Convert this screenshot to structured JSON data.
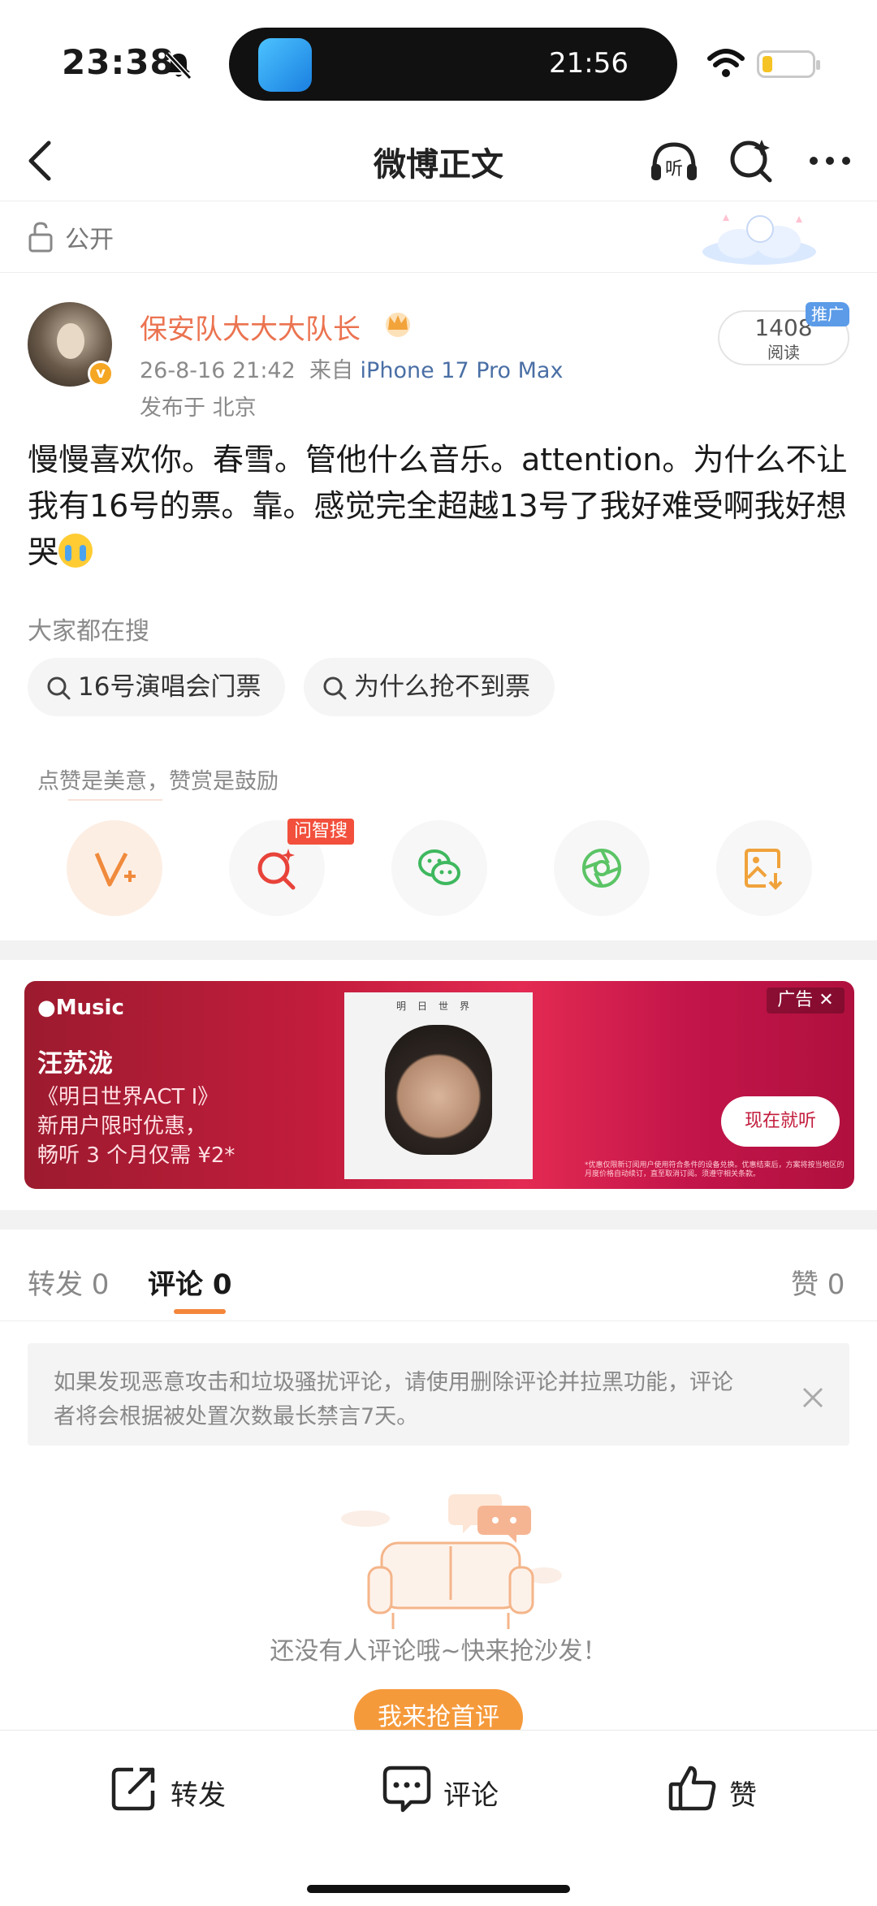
{
  "status_bar": {
    "time": "23:38",
    "island_time": "21:56",
    "battery_color": "#f6c324"
  },
  "nav": {
    "title": "微博正文",
    "icons": [
      "back-icon",
      "listen-icon",
      "search-spark-icon",
      "more-icon"
    ],
    "listen_glyph": "听"
  },
  "visibility": {
    "label": "公开",
    "icon": "lock-open-icon"
  },
  "post": {
    "author": "保安队大大大队长",
    "verified_badge": "v",
    "date": "26-8-16 21:42",
    "source_prefix": "来自",
    "source": "iPhone 17 Pro Max",
    "location": "发布于 北京",
    "reads_count": "1408",
    "reads_label": "阅读",
    "promo_tag": "推广",
    "text": "慢慢喜欢你。春雪。管他什么音乐。attention。为什么不让我有16号的票。靠。感觉完全超越13号了我好难受啊我好想哭"
  },
  "trending": {
    "title": "大家都在搜",
    "chips": [
      "16号演唱会门票",
      "为什么抢不到票"
    ]
  },
  "actions": {
    "hint": "点赞是美意，赞赏是鼓励",
    "wzs_badge": "问智搜",
    "items": [
      "reward-icon",
      "ai-search-icon",
      "wechat-icon",
      "moments-icon",
      "save-image-icon"
    ]
  },
  "ad": {
    "brand": "Music",
    "artist": "汪苏泷",
    "line1": "《明日世界ACT I》",
    "line2": "新用户限时优惠，",
    "line3": "畅听 3 个月仅需 ¥2*",
    "album_title": "明日世界",
    "tag": "广告 ✕",
    "button": "现在就听",
    "fine_print": "*优惠仅限新订阅用户使用符合条件的设备兑换。优惠结束后，方案将按当地区的月度价格自动续订，直至取消订阅。须遵守相关条款。"
  },
  "tabs": {
    "repost": "转发 0",
    "comment": "评论 0",
    "like": "赞 0",
    "accent": "#f4863a"
  },
  "notice": {
    "text": "如果发现恶意攻击和垃圾骚扰评论，请使用删除评论并拉黑功能，评论者将会根据被处置次数最长禁言7天。"
  },
  "empty_state": {
    "text": "还没有人评论哦~快来抢沙发！",
    "button": "我来抢首评"
  },
  "bottom_bar": {
    "repost": "转发",
    "comment": "评论",
    "like": "赞"
  }
}
